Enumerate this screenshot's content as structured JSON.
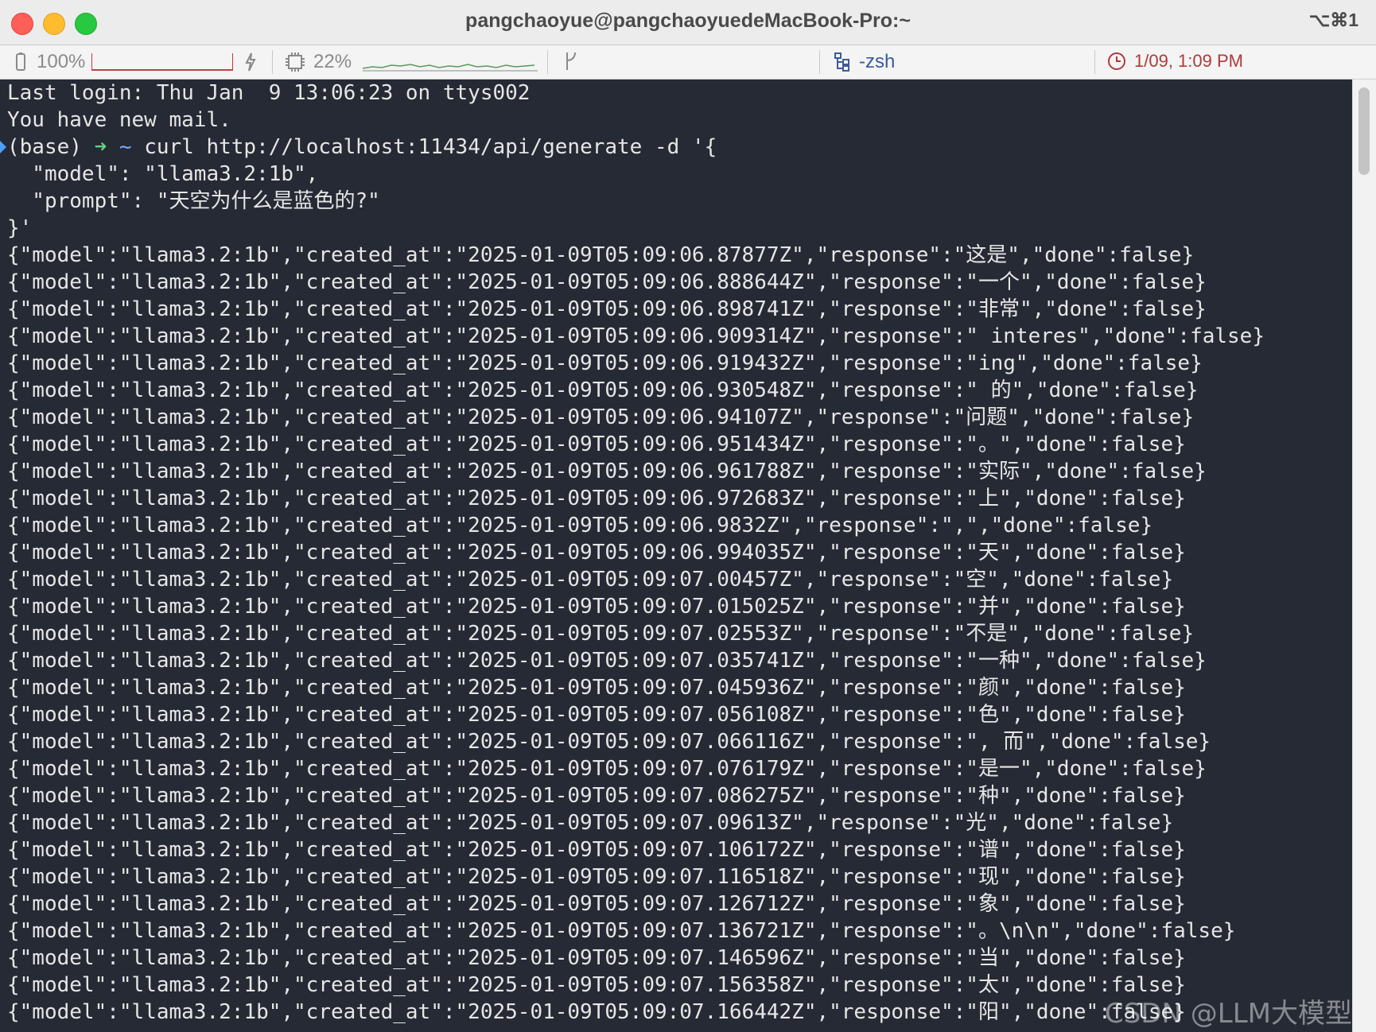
{
  "window": {
    "title": "pangchaoyue@pangchaoyuedeMacBook-Pro:~",
    "shortcut": "⌥⌘1"
  },
  "status": {
    "battery_label": "100%",
    "battery_level": 1.0,
    "cpu_label": "22%",
    "shell": "-zsh",
    "datetime": "1/09, 1:09 PM",
    "icons": [
      "battery-icon",
      "lightning-icon",
      "cpu-icon",
      "branch-icon",
      "tree-icon",
      "clock-icon"
    ]
  },
  "terminal": {
    "lines": [
      "Last login: Thu Jan  9 13:06:23 on ttys002",
      "You have new mail.",
      "",
      "  \"model\": \"llama3.2:1b\",",
      "  \"prompt\": \"天空为什么是蓝色的?\"",
      "}'",
      "{\"model\":\"llama3.2:1b\",\"created_at\":\"2025-01-09T05:09:06.87877Z\",\"response\":\"这是\",\"done\":false}",
      "{\"model\":\"llama3.2:1b\",\"created_at\":\"2025-01-09T05:09:06.888644Z\",\"response\":\"一个\",\"done\":false}",
      "{\"model\":\"llama3.2:1b\",\"created_at\":\"2025-01-09T05:09:06.898741Z\",\"response\":\"非常\",\"done\":false}",
      "{\"model\":\"llama3.2:1b\",\"created_at\":\"2025-01-09T05:09:06.909314Z\",\"response\":\" interes\",\"done\":false}",
      "{\"model\":\"llama3.2:1b\",\"created_at\":\"2025-01-09T05:09:06.919432Z\",\"response\":\"ing\",\"done\":false}",
      "{\"model\":\"llama3.2:1b\",\"created_at\":\"2025-01-09T05:09:06.930548Z\",\"response\":\" 的\",\"done\":false}",
      "{\"model\":\"llama3.2:1b\",\"created_at\":\"2025-01-09T05:09:06.94107Z\",\"response\":\"问题\",\"done\":false}",
      "{\"model\":\"llama3.2:1b\",\"created_at\":\"2025-01-09T05:09:06.951434Z\",\"response\":\"。\",\"done\":false}",
      "{\"model\":\"llama3.2:1b\",\"created_at\":\"2025-01-09T05:09:06.961788Z\",\"response\":\"实际\",\"done\":false}",
      "{\"model\":\"llama3.2:1b\",\"created_at\":\"2025-01-09T05:09:06.972683Z\",\"response\":\"上\",\"done\":false}",
      "{\"model\":\"llama3.2:1b\",\"created_at\":\"2025-01-09T05:09:06.9832Z\",\"response\":\",\",\"done\":false}",
      "{\"model\":\"llama3.2:1b\",\"created_at\":\"2025-01-09T05:09:06.994035Z\",\"response\":\"天\",\"done\":false}",
      "{\"model\":\"llama3.2:1b\",\"created_at\":\"2025-01-09T05:09:07.00457Z\",\"response\":\"空\",\"done\":false}",
      "{\"model\":\"llama3.2:1b\",\"created_at\":\"2025-01-09T05:09:07.015025Z\",\"response\":\"并\",\"done\":false}",
      "{\"model\":\"llama3.2:1b\",\"created_at\":\"2025-01-09T05:09:07.02553Z\",\"response\":\"不是\",\"done\":false}",
      "{\"model\":\"llama3.2:1b\",\"created_at\":\"2025-01-09T05:09:07.035741Z\",\"response\":\"一种\",\"done\":false}",
      "{\"model\":\"llama3.2:1b\",\"created_at\":\"2025-01-09T05:09:07.045936Z\",\"response\":\"颜\",\"done\":false}",
      "{\"model\":\"llama3.2:1b\",\"created_at\":\"2025-01-09T05:09:07.056108Z\",\"response\":\"色\",\"done\":false}",
      "{\"model\":\"llama3.2:1b\",\"created_at\":\"2025-01-09T05:09:07.066116Z\",\"response\":\", 而\",\"done\":false}",
      "{\"model\":\"llama3.2:1b\",\"created_at\":\"2025-01-09T05:09:07.076179Z\",\"response\":\"是一\",\"done\":false}",
      "{\"model\":\"llama3.2:1b\",\"created_at\":\"2025-01-09T05:09:07.086275Z\",\"response\":\"种\",\"done\":false}",
      "{\"model\":\"llama3.2:1b\",\"created_at\":\"2025-01-09T05:09:07.09613Z\",\"response\":\"光\",\"done\":false}",
      "{\"model\":\"llama3.2:1b\",\"created_at\":\"2025-01-09T05:09:07.106172Z\",\"response\":\"谱\",\"done\":false}",
      "{\"model\":\"llama3.2:1b\",\"created_at\":\"2025-01-09T05:09:07.116518Z\",\"response\":\"现\",\"done\":false}",
      "{\"model\":\"llama3.2:1b\",\"created_at\":\"2025-01-09T05:09:07.126712Z\",\"response\":\"象\",\"done\":false}",
      "{\"model\":\"llama3.2:1b\",\"created_at\":\"2025-01-09T05:09:07.136721Z\",\"response\":\"。\\n\\n\",\"done\":false}",
      "{\"model\":\"llama3.2:1b\",\"created_at\":\"2025-01-09T05:09:07.146596Z\",\"response\":\"当\",\"done\":false}",
      "{\"model\":\"llama3.2:1b\",\"created_at\":\"2025-01-09T05:09:07.156358Z\",\"response\":\"太\",\"done\":false}",
      "{\"model\":\"llama3.2:1b\",\"created_at\":\"2025-01-09T05:09:07.166442Z\",\"response\":\"阳\",\"done\":false}"
    ],
    "prompt": {
      "env": "(base)",
      "arrow": "➜",
      "cwd": "~",
      "command": "curl http://localhost:11434/api/generate -d '{"
    }
  },
  "watermark": "CSDN @LLM大模型",
  "colors": {
    "terminal_bg": "#252a35",
    "accent": "#4aa0ff"
  }
}
